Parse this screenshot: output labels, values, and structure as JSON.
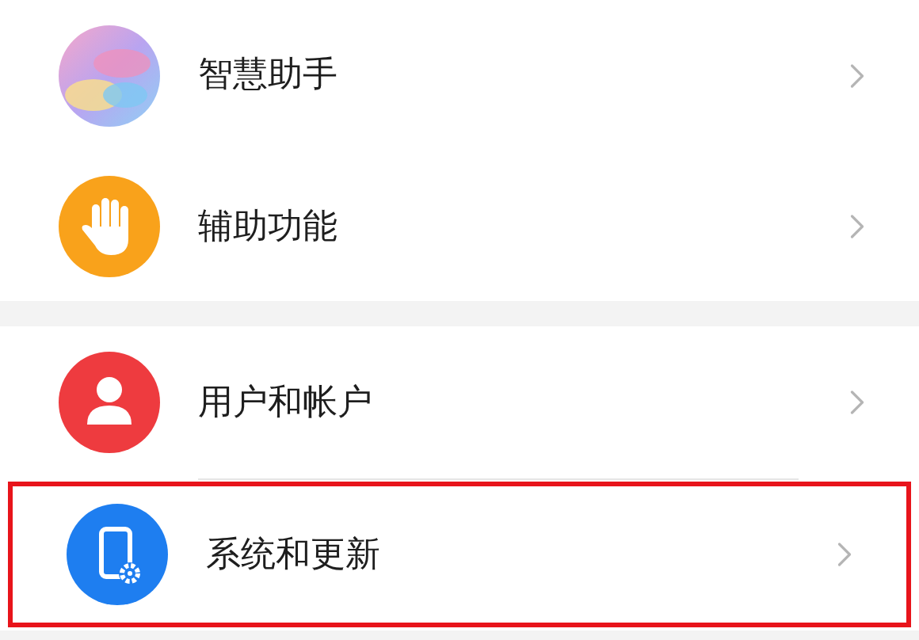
{
  "groups": [
    {
      "items": [
        {
          "label": "智慧助手",
          "kind": "orb",
          "highlighted": false
        },
        {
          "label": "辅助功能",
          "kind": "hand",
          "highlighted": false
        }
      ]
    },
    {
      "items": [
        {
          "label": "用户和帐户",
          "kind": "user",
          "highlighted": false
        },
        {
          "label": "系统和更新",
          "kind": "phone",
          "highlighted": true
        }
      ]
    }
  ]
}
